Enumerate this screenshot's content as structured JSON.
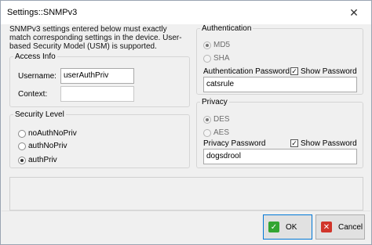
{
  "window": {
    "title": "Settings::SNMPv3",
    "close_glyph": "✕"
  },
  "intro_text": "SNMPv3 settings entered below must exactly match corresponding settings in the device. User-based Security Model (USM) is supported.",
  "access_info": {
    "legend": "Access Info",
    "username_label": "Username:",
    "username_value": "userAuthPriv",
    "context_label": "Context:",
    "context_value": ""
  },
  "security_level": {
    "legend": "Security Level",
    "options": [
      {
        "label": "noAuthNoPriv",
        "checked": false
      },
      {
        "label": "authNoPriv",
        "checked": false
      },
      {
        "label": "authPriv",
        "checked": true
      }
    ]
  },
  "authentication": {
    "legend": "Authentication",
    "options": [
      {
        "label": "MD5",
        "checked": true
      },
      {
        "label": "SHA",
        "checked": false
      }
    ],
    "password_label": "Authentication Password",
    "show_password_label": "Show Password",
    "show_password_checked": true,
    "password_value": "catsrule"
  },
  "privacy": {
    "legend": "Privacy",
    "options": [
      {
        "label": "DES",
        "checked": true
      },
      {
        "label": "AES",
        "checked": false
      }
    ],
    "password_label": "Privacy Password",
    "show_password_label": "Show Password",
    "show_password_checked": true,
    "password_value": "dogsdrool"
  },
  "buttons": {
    "ok_label": "OK",
    "cancel_label": "Cancel"
  },
  "icons": {
    "ok": "check-icon",
    "cancel": "x-icon"
  },
  "colors": {
    "ok_icon": "#33a532",
    "cancel_icon": "#d1352b",
    "default_button_border": "#0078d7"
  }
}
